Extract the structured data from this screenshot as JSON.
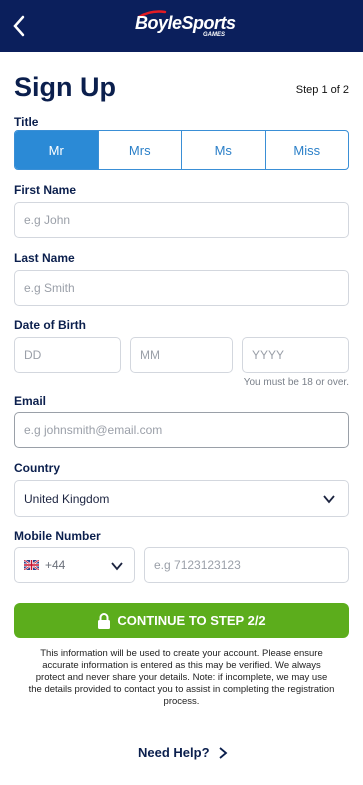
{
  "header": {
    "logo_main": "BoyleSports",
    "logo_sub": "GAMES"
  },
  "page": {
    "title": "Sign Up",
    "step": "Step 1 of 2"
  },
  "title_field": {
    "label": "Title",
    "options": [
      "Mr",
      "Mrs",
      "Ms",
      "Miss"
    ],
    "selected": "Mr"
  },
  "first_name": {
    "label": "First Name",
    "placeholder": "e.g John"
  },
  "last_name": {
    "label": "Last Name",
    "placeholder": "e.g Smith"
  },
  "dob": {
    "label": "Date of Birth",
    "day": "DD",
    "month": "MM",
    "year": "YYYY",
    "hint": "You must be 18 or over."
  },
  "email": {
    "label": "Email",
    "placeholder": "e.g johnsmith@email.com"
  },
  "country": {
    "label": "Country",
    "value": "United Kingdom"
  },
  "mobile": {
    "label": "Mobile Number",
    "code": "+44",
    "placeholder": "e.g 7123123123"
  },
  "cta": {
    "label": "CONTINUE TO STEP 2/2"
  },
  "info": "This information will be used to create your account. Please ensure accurate information is entered as this may be verified. We always protect and never share your details. Note: if incomplete, we may use the details provided to contact you to assist in completing the registration process.",
  "help": {
    "label": "Need Help?"
  },
  "colors": {
    "header": "#0b1f5c",
    "accent": "#2b8ad6",
    "cta": "#5cad1c",
    "brand_red": "#e31b23"
  }
}
